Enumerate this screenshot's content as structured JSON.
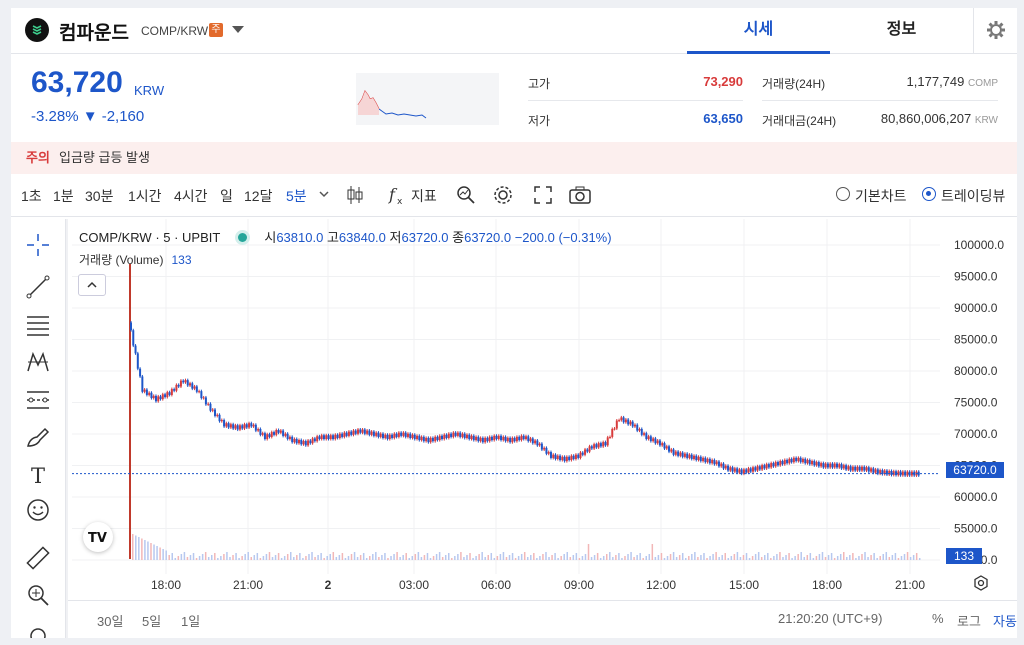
{
  "header": {
    "coin_name": "컴파운드",
    "pair": "COMP/KRW",
    "warning_badge": "주",
    "tabs": [
      "시세",
      "정보"
    ]
  },
  "summary": {
    "price": "63,720",
    "price_unit": "KRW",
    "change": "-3.28% ▼ -2,160",
    "high_label": "고가",
    "high_value": "73,290",
    "low_label": "저가",
    "low_value": "63,650",
    "volume_label": "거래량(24H)",
    "volume_value": "1,177,749",
    "volume_unit": "COMP",
    "amount_label": "거래대금(24H)",
    "amount_value": "80,860,006,207",
    "amount_unit": "KRW"
  },
  "notice": {
    "tag": "주의",
    "text": "입금량 급등 발생"
  },
  "toolbar": {
    "intervals": [
      "1초",
      "1분",
      "30분",
      "1시간",
      "4시간",
      "일",
      "12달",
      "5분"
    ],
    "active_interval": "5분",
    "indicator_label": "지표",
    "basic_chart": "기본차트",
    "trading_view": "트레이딩뷰"
  },
  "chart": {
    "symbol": "COMP/KRW · 5 · UPBIT",
    "o_label": "시",
    "o": "63810.0",
    "h_label": "고",
    "h": "63840.0",
    "l_label": "저",
    "l": "63720.0",
    "c_label": "종",
    "c": "63720.0",
    "chg": "−200.0 (−0.31%)",
    "volume_label": "거래량 (Volume)",
    "volume_value": "133",
    "last_price_tag": "63720.0",
    "volume_tag": "133",
    "yaxis": [
      "100000.0",
      "95000.0",
      "90000.0",
      "85000.0",
      "80000.0",
      "75000.0",
      "70000.0",
      "65000.0",
      "60000.0",
      "55000.0",
      "50000.0"
    ],
    "xaxis": [
      "18:00",
      "21:00",
      "2",
      "03:00",
      "06:00",
      "09:00",
      "12:00",
      "15:00",
      "18:00",
      "21:00"
    ]
  },
  "bottom": {
    "ranges": [
      "30일",
      "5일",
      "1일"
    ],
    "clock": "21:20:20 (UTC+9)",
    "pct": "%",
    "log": "로그",
    "auto": "자동"
  },
  "colors": {
    "up": "#d83b3b",
    "down": "#1d56c9",
    "warning": "#e26a2c"
  },
  "chart_data": {
    "type": "line",
    "ylim": [
      50000,
      100000
    ],
    "x": [
      "16:30",
      "17:00",
      "17:30",
      "18:00",
      "18:30",
      "19:00",
      "19:30",
      "20:00",
      "20:30",
      "21:00",
      "21:30",
      "22:00",
      "22:30",
      "23:00",
      "23:30",
      "00:00",
      "00:30",
      "01:00",
      "01:30",
      "02:00",
      "02:30",
      "03:00",
      "03:30",
      "04:00",
      "04:30",
      "05:00",
      "05:30",
      "06:00",
      "06:30",
      "07:00",
      "07:30",
      "08:00",
      "08:30",
      "09:00",
      "09:30",
      "10:00",
      "10:30",
      "11:00",
      "11:30",
      "12:00",
      "12:30",
      "13:00",
      "13:30",
      "14:00",
      "14:30",
      "15:00",
      "15:30",
      "16:00",
      "16:30",
      "17:00",
      "17:30",
      "18:00",
      "18:30",
      "19:00",
      "19:30",
      "20:00",
      "20:30",
      "21:00",
      "21:20"
    ],
    "series": [
      {
        "values": [
          88000,
          77000,
          75500,
          76500,
          78500,
          77000,
          74000,
          71500,
          71000,
          71500,
          69500,
          70500,
          69000,
          68500,
          69500,
          69500,
          70000,
          70500,
          70000,
          69500,
          70000,
          69500,
          69000,
          69500,
          70000,
          69500,
          69000,
          69500,
          69000,
          69500,
          68500,
          66500,
          66000,
          66500,
          68000,
          68500,
          72500,
          71500,
          69500,
          68500,
          67000,
          66500,
          66000,
          65500,
          64500,
          64000,
          64500,
          65000,
          65500,
          66000,
          65500,
          65000,
          65000,
          64500,
          64500,
          64000,
          63800,
          63720,
          63720
        ]
      }
    ]
  }
}
